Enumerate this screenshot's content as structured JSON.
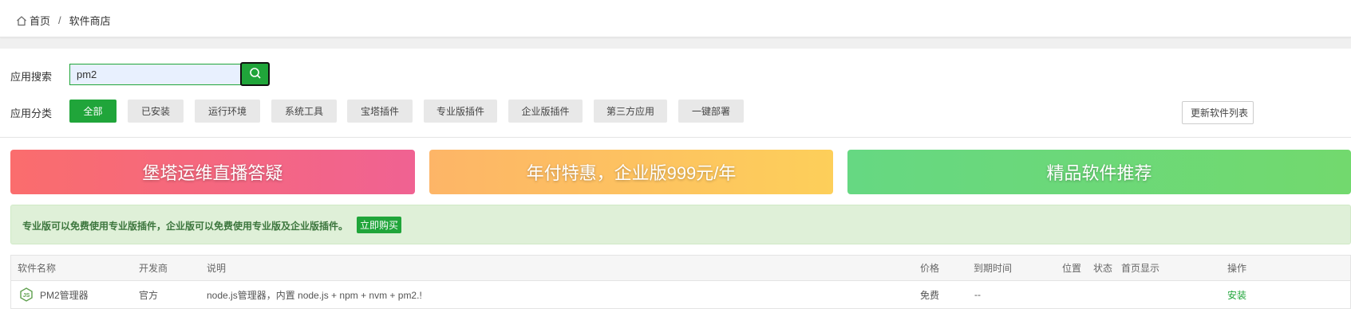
{
  "breadcrumb": {
    "home": "首页",
    "separator": "/",
    "current": "软件商店"
  },
  "search": {
    "label": "应用搜索",
    "value": "pm2",
    "button_icon": "search-icon"
  },
  "categories": {
    "label": "应用分类",
    "items": [
      "全部",
      "已安装",
      "运行环境",
      "系统工具",
      "宝塔插件",
      "专业版插件",
      "企业版插件",
      "第三方应用",
      "一键部署"
    ],
    "active": "全部"
  },
  "update_list_label": "更新软件列表",
  "banners": [
    "堡塔运维直播答疑",
    "年付特惠，企业版999元/年",
    "精品软件推荐"
  ],
  "notice": {
    "text": "专业版可以免费使用专业版插件，企业版可以免费使用专业版及企业版插件。",
    "buy_label": "立即购买"
  },
  "table": {
    "headers": [
      "软件名称",
      "开发商",
      "说明",
      "价格",
      "到期时间",
      "位置",
      "状态",
      "首页显示",
      "操作"
    ],
    "rows": [
      {
        "name": "PM2管理器",
        "icon": "nodejs-icon",
        "developer": "官方",
        "description": "node.js管理器，内置 node.js + npm + nvm + pm2.!",
        "price": "免费",
        "expire": "--",
        "action": "安装"
      }
    ]
  },
  "colors": {
    "accent": "#20a53a",
    "notice_bg": "#dff0d8",
    "notice_text": "#3c763d"
  }
}
